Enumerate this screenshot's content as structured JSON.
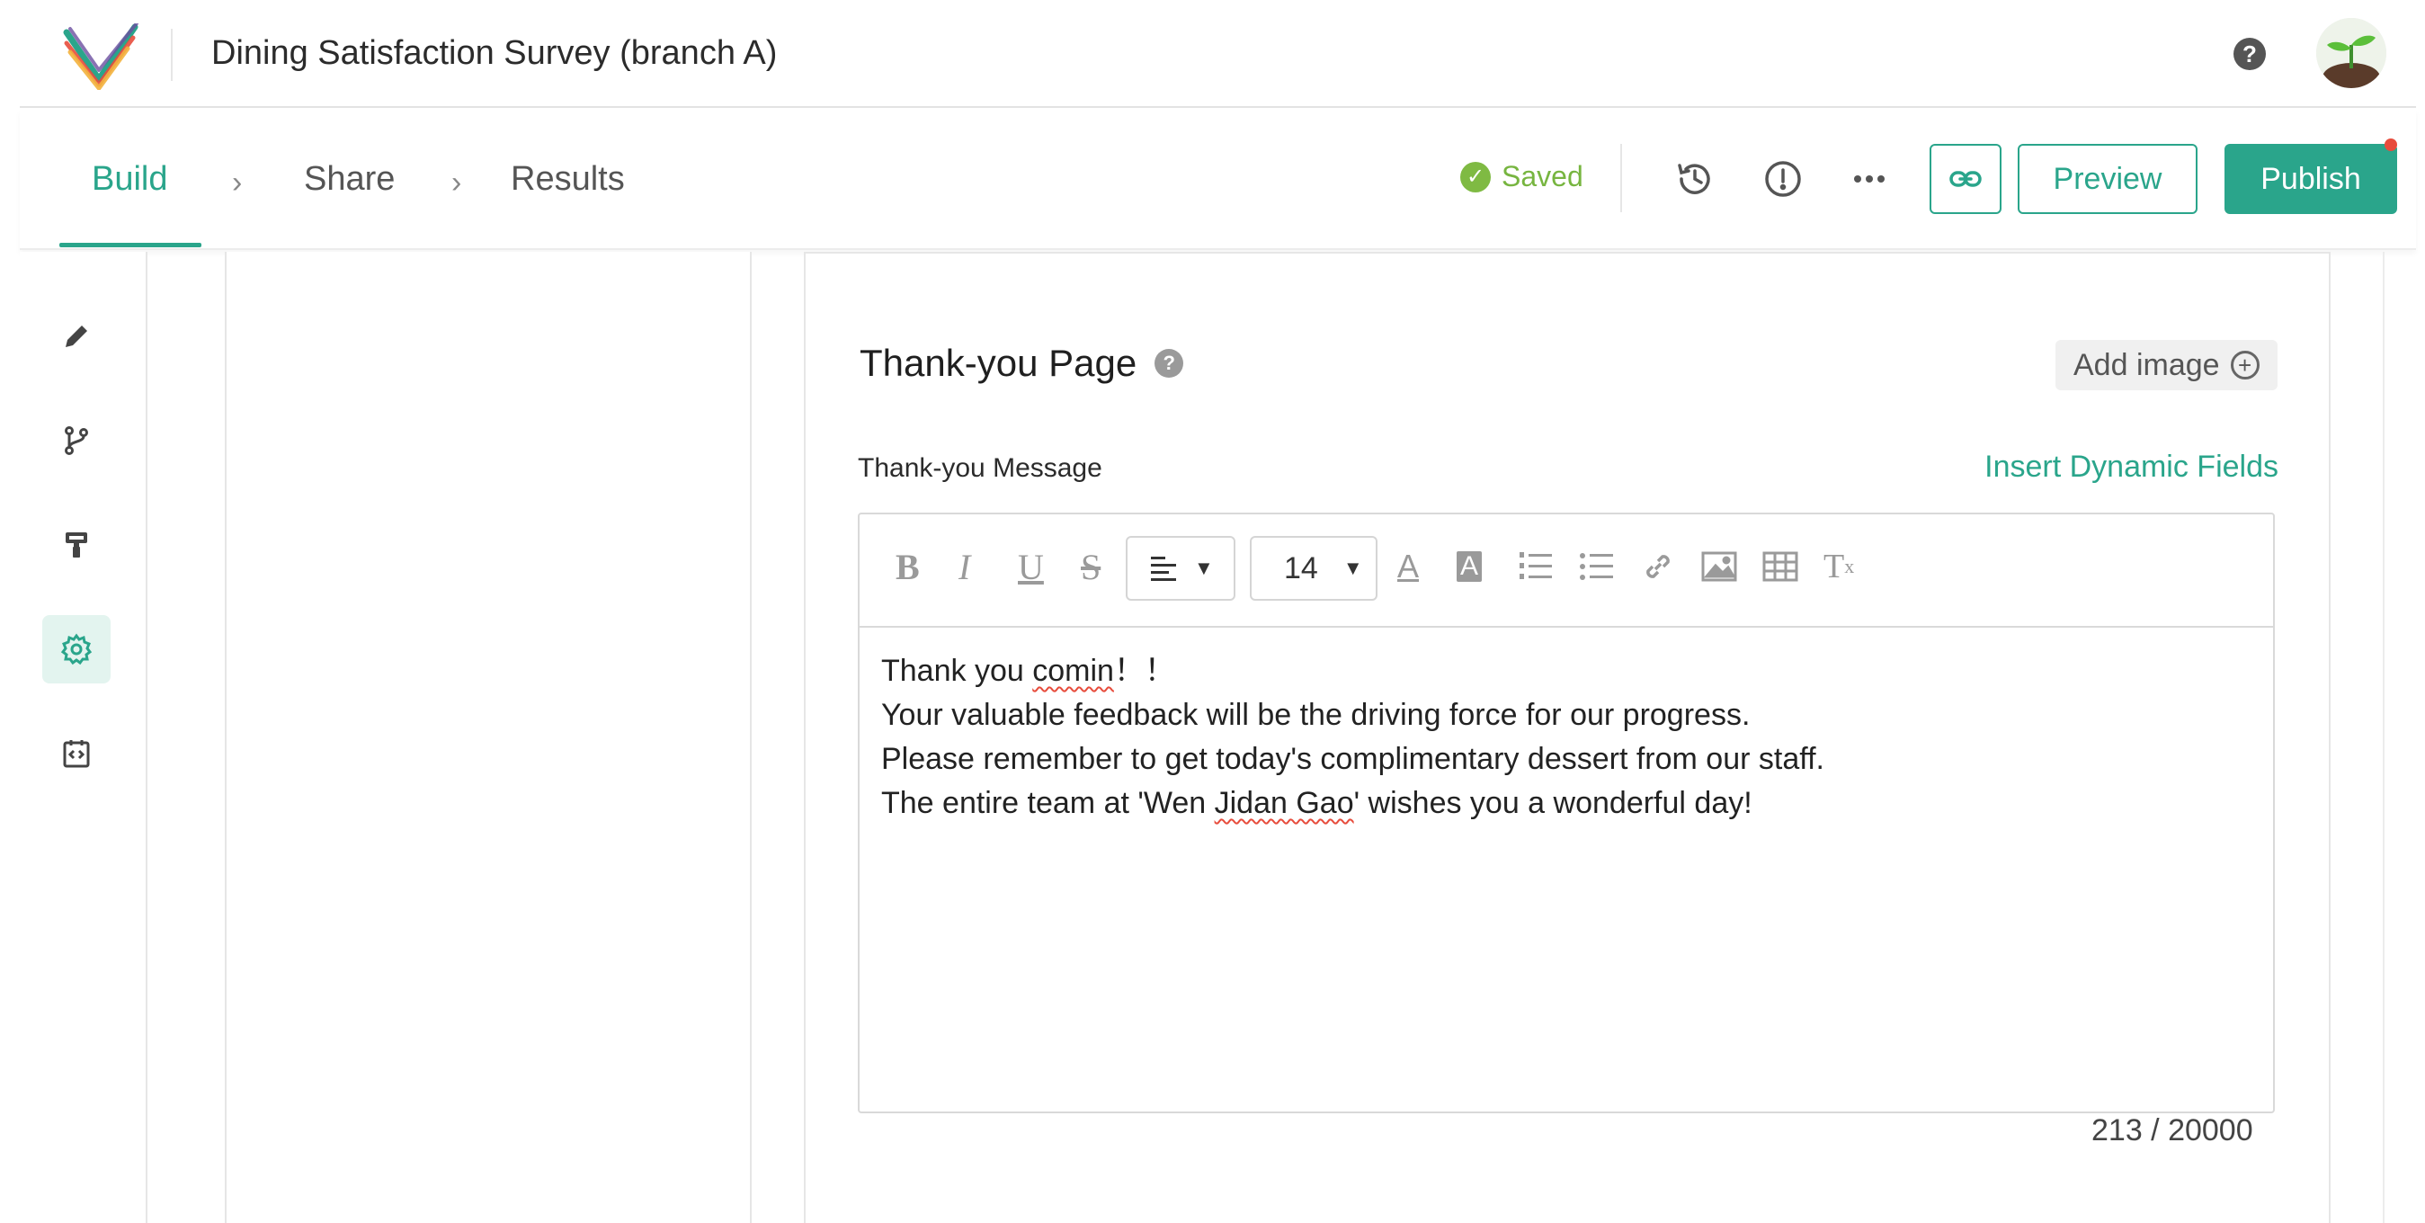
{
  "header": {
    "app_title": "Dining Satisfaction Survey (branch A)",
    "help_glyph": "?"
  },
  "steps": [
    {
      "label": "Build",
      "active": true
    },
    {
      "label": "Share",
      "active": false
    },
    {
      "label": "Results",
      "active": false
    }
  ],
  "status": {
    "saved_label": "Saved",
    "color": "#7fba43"
  },
  "toolbar": {
    "preview_label": "Preview",
    "publish_label": "Publish",
    "icons": [
      "history-icon",
      "warning-icon",
      "more-icon",
      "link-icon"
    ]
  },
  "rail": {
    "items": [
      {
        "icon": "pencil-icon",
        "active": false
      },
      {
        "icon": "branch-icon",
        "active": false
      },
      {
        "icon": "paint-roller-icon",
        "active": false
      },
      {
        "icon": "gear-icon",
        "active": true
      },
      {
        "icon": "code-icon",
        "active": false
      }
    ]
  },
  "thankyou": {
    "title": "Thank-you Page",
    "help_glyph": "?",
    "add_image_label": "Add image",
    "message_label": "Thank-you Message",
    "insert_link": "Insert Dynamic Fields",
    "font_size": "14",
    "message_lines": [
      {
        "before": "Thank you ",
        "flagged": "comin",
        "after": "！！"
      },
      {
        "before": "Your valuable feedback will be the driving force for our progress.",
        "flagged": "",
        "after": ""
      },
      {
        "before": "Please remember to get today's complimentary dessert from our staff.",
        "flagged": "",
        "after": ""
      },
      {
        "before": "The entire team at 'Wen ",
        "flagged": "Jidan Gao",
        "after": "' wishes you a wonderful day!"
      }
    ],
    "char_count": "213 / 20000"
  },
  "colors": {
    "accent": "#2aa58b",
    "notification": "#e74c3c"
  }
}
